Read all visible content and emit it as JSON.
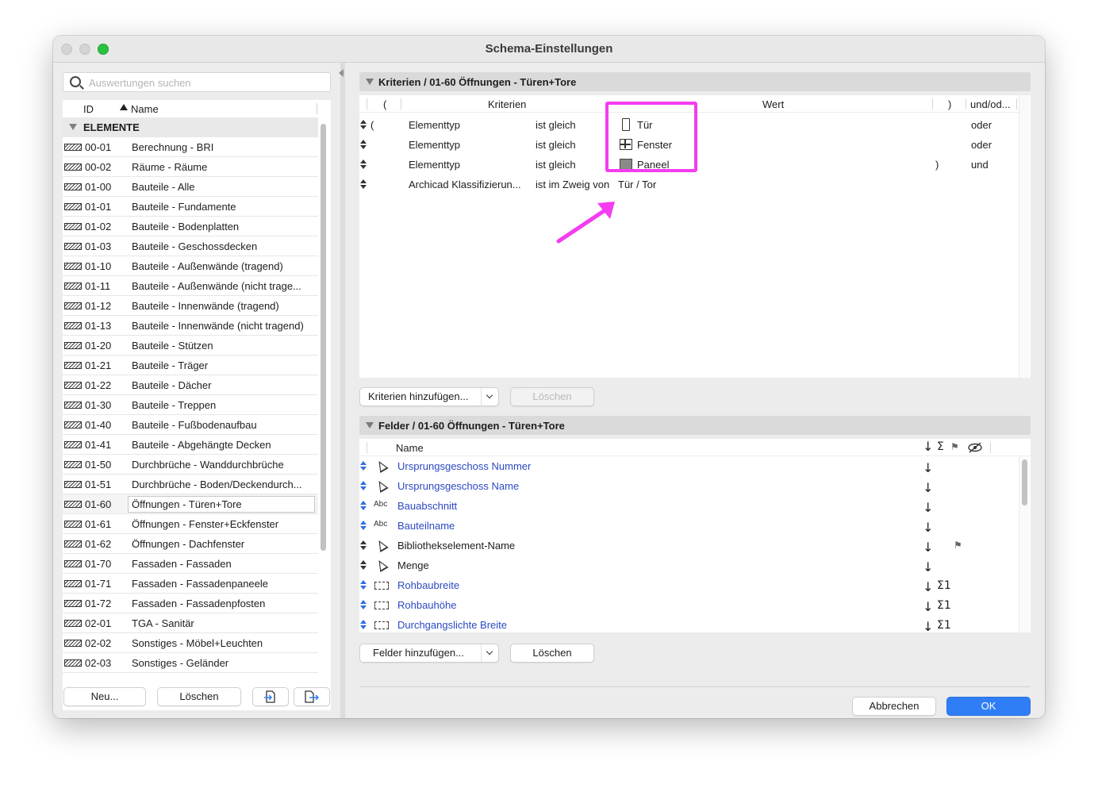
{
  "window": {
    "title": "Schema-Einstellungen"
  },
  "left": {
    "search_placeholder": "Auswertungen suchen",
    "col_id": "ID",
    "col_name": "Name",
    "group_label": "ELEMENTE",
    "rows": [
      {
        "id": "00-01",
        "name": "Berechnung - BRI"
      },
      {
        "id": "00-02",
        "name": "Räume - Räume"
      },
      {
        "id": "01-00",
        "name": "Bauteile - Alle"
      },
      {
        "id": "01-01",
        "name": "Bauteile - Fundamente"
      },
      {
        "id": "01-02",
        "name": "Bauteile - Bodenplatten"
      },
      {
        "id": "01-03",
        "name": "Bauteile - Geschossdecken"
      },
      {
        "id": "01-10",
        "name": "Bauteile - Außenwände (tragend)"
      },
      {
        "id": "01-11",
        "name": "Bauteile - Außenwände (nicht trage..."
      },
      {
        "id": "01-12",
        "name": "Bauteile - Innenwände (tragend)"
      },
      {
        "id": "01-13",
        "name": "Bauteile - Innenwände (nicht tragend)"
      },
      {
        "id": "01-20",
        "name": "Bauteile - Stützen"
      },
      {
        "id": "01-21",
        "name": "Bauteile - Träger"
      },
      {
        "id": "01-22",
        "name": "Bauteile - Dächer"
      },
      {
        "id": "01-30",
        "name": "Bauteile - Treppen"
      },
      {
        "id": "01-40",
        "name": "Bauteile - Fußbodenaufbau"
      },
      {
        "id": "01-41",
        "name": "Bauteile - Abgehängte Decken"
      },
      {
        "id": "01-50",
        "name": "Durchbrüche - Wanddurchbrüche"
      },
      {
        "id": "01-51",
        "name": "Durchbrüche - Boden/Deckendurch..."
      },
      {
        "id": "01-60",
        "name": "Öffnungen - Türen+Tore"
      },
      {
        "id": "01-61",
        "name": "Öffnungen - Fenster+Eckfenster"
      },
      {
        "id": "01-62",
        "name": "Öffnungen - Dachfenster"
      },
      {
        "id": "01-70",
        "name": "Fassaden - Fassaden"
      },
      {
        "id": "01-71",
        "name": "Fassaden - Fassadenpaneele"
      },
      {
        "id": "01-72",
        "name": "Fassaden - Fassadenpfosten"
      },
      {
        "id": "02-01",
        "name": "TGA - Sanitär"
      },
      {
        "id": "02-02",
        "name": "Sonstiges - Möbel+Leuchten"
      },
      {
        "id": "02-03",
        "name": "Sonstiges - Geländer"
      }
    ],
    "new_label": "Neu...",
    "delete_label": "Löschen"
  },
  "criteria": {
    "header": "Kriterien / 01-60 Öffnungen - Türen+Tore",
    "col_open": "(",
    "col_criteria": "Kriterien",
    "col_value": "Wert",
    "col_close": ")",
    "col_andor": "und/od...",
    "rows": [
      {
        "open": "(",
        "field": "Elementtyp",
        "op": "ist gleich",
        "value": "Tür",
        "close": "",
        "andor": "oder"
      },
      {
        "open": "",
        "field": "Elementtyp",
        "op": "ist gleich",
        "value": "Fenster",
        "close": "",
        "andor": "oder"
      },
      {
        "open": "",
        "field": "Elementtyp",
        "op": "ist gleich",
        "value": "Paneel",
        "close": ")",
        "andor": "und"
      },
      {
        "open": "",
        "field": "Archicad Klassifizierun...",
        "op": "ist im Zweig von",
        "value": "Tür / Tor",
        "close": "",
        "andor": ""
      }
    ],
    "add_label": "Kriterien hinzufügen...",
    "delete_label": "Löschen"
  },
  "fields": {
    "header": "Felder / 01-60 Öffnungen - Türen+Tore",
    "col_name": "Name",
    "rows": [
      {
        "icon": "cursor-icon",
        "name": "Ursprungsgeschoss Nummer",
        "link": true,
        "sort": "↓",
        "sum": "",
        "flag": false
      },
      {
        "icon": "cursor-icon",
        "name": "Ursprungsgeschoss Name",
        "link": true,
        "sort": "↓",
        "sum": "",
        "flag": false
      },
      {
        "icon": "abc-icon",
        "name": "Bauabschnitt",
        "link": true,
        "sort": "↓",
        "sum": "",
        "flag": false
      },
      {
        "icon": "abc-icon",
        "name": "Bauteilname",
        "link": true,
        "sort": "↓",
        "sum": "",
        "flag": false
      },
      {
        "icon": "cursor-icon",
        "name": "Bibliothekselement-Name",
        "link": false,
        "sort": "↓",
        "sum": "",
        "flag": true
      },
      {
        "icon": "cursor-icon",
        "name": "Menge",
        "link": false,
        "sort": "↓",
        "sum": "",
        "flag": false
      },
      {
        "icon": "dimension-icon",
        "name": "Rohbaubreite",
        "link": true,
        "sort": "↓",
        "sum": "Σ1",
        "flag": false
      },
      {
        "icon": "dimension-icon",
        "name": "Rohbauhöhe",
        "link": true,
        "sort": "↓",
        "sum": "Σ1",
        "flag": false
      },
      {
        "icon": "dimension-icon",
        "name": "Durchgangslichte Breite",
        "link": true,
        "sort": "↓",
        "sum": "Σ1",
        "flag": false
      }
    ],
    "add_label": "Felder hinzufügen...",
    "delete_label": "Löschen"
  },
  "footer": {
    "cancel_label": "Abbrechen",
    "ok_label": "OK"
  },
  "colors": {
    "accent": "#2f7ef6",
    "highlight": "#f43cf0",
    "link": "#2b49c2"
  }
}
